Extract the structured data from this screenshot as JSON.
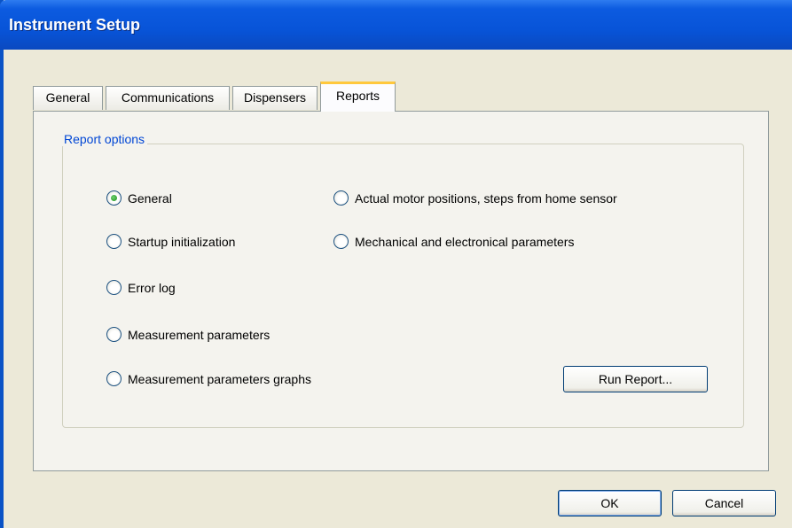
{
  "window": {
    "title": "Instrument Setup"
  },
  "tabs": [
    {
      "label": "General",
      "active": false
    },
    {
      "label": "Communications",
      "active": false
    },
    {
      "label": "Dispensers",
      "active": false
    },
    {
      "label": "Reports",
      "active": true
    }
  ],
  "report_options": {
    "legend": "Report options",
    "selected": "General",
    "options": [
      {
        "label": "General",
        "checked": true
      },
      {
        "label": "Startup initialization",
        "checked": false
      },
      {
        "label": "Error log",
        "checked": false
      },
      {
        "label": "Measurement parameters",
        "checked": false
      },
      {
        "label": "Measurement parameters graphs",
        "checked": false
      },
      {
        "label": "Actual motor positions, steps from home sensor",
        "checked": false
      },
      {
        "label": "Mechanical and electronical parameters",
        "checked": false
      }
    ],
    "run_report_label": "Run Report..."
  },
  "footer": {
    "ok_label": "OK",
    "cancel_label": "Cancel"
  }
}
